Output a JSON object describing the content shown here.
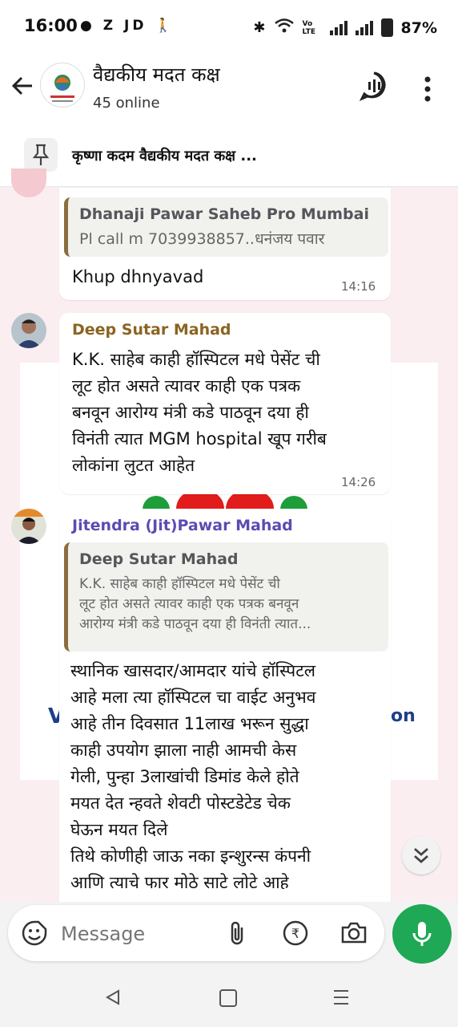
{
  "status_bar": {
    "time": "16:00",
    "left_icons": "Z JD",
    "battery": "87%",
    "network": "Vo LTE"
  },
  "header": {
    "title": "वैद्यकीय मदत कक्ष",
    "subtitle": "45 online"
  },
  "pinned": {
    "text": "कृष्णा कदम वैद्यकीय मदत कक्ष ..."
  },
  "messages": [
    {
      "quote_name": "Dhanaji Pawar Saheb Pro Mumbai",
      "quote_text": "Pl call m 7039938857..धनंजय पवार",
      "text": "Khup dhnyavad",
      "time": "14:16"
    },
    {
      "sender": "Deep Sutar Mahad",
      "sender_color": "#8a6420",
      "lines": [
        "K.K. साहेब काही हॉस्पिटल मधे पेसेंट ची",
        "लूट होत असते त्यावर काही एक पत्रक",
        "बनवून आरोग्य मंत्री कडे पाठवून दया ही",
        "विनंती त्यात MGM hospital खूप गरीब",
        "लोकांना लुटत आहेत"
      ],
      "time": "14:26"
    },
    {
      "sender": "Jitendra (Jit)Pawar Mahad",
      "sender_color": "#5b4bb3",
      "quote_name": "Deep Sutar Mahad",
      "quote_lines": [
        "K.K. साहेब काही हॉस्पिटल मधे पेसेंट ची",
        "लूट होत असते त्यावर काही एक पत्रक बनवून",
        "आरोग्य मंत्री कडे पाठवून दया ही विनंती त्यात..."
      ],
      "lines": [
        "स्थानिक खासदार/आमदार यांचे हॉस्पिटल",
        "आहे मला त्या हॉस्पिटल चा वाईट अनुभव",
        "आहे तीन दिवसात 11लाख भरून सुद्धा",
        "काही उपयोग झाला नाही आमची केस",
        "गेली, पुन्हा 3लाखांची डिमांड केले होते",
        "मयत देत न्हवते शेवटी पोस्टडेटेड चेक",
        "घेऊन मयत दिले",
        "तिथे कोणीही जाऊ नका इन्शुरन्स कंपनी",
        "आणि त्याचे फार मोठे साटे लोटे आहे"
      ]
    }
  ],
  "background_text": {
    "left": "V",
    "right": "on"
  },
  "composer": {
    "placeholder": "Message"
  }
}
